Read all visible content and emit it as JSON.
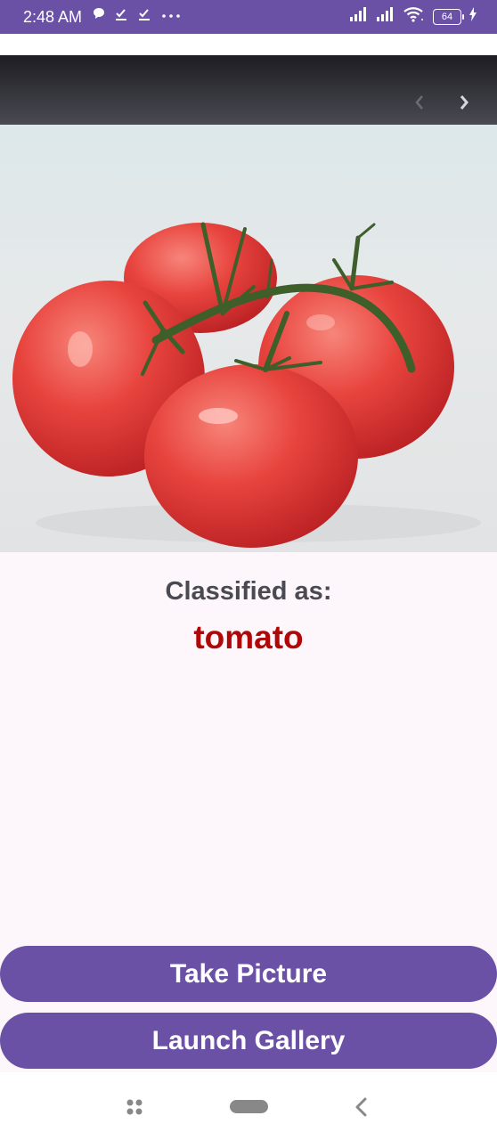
{
  "status_bar": {
    "time": "2:48 AM",
    "left_icons": [
      "chat-bubble-icon",
      "check-icon",
      "check-icon",
      "more-dots-icon"
    ],
    "battery_level": "64",
    "bg_color": "#6A51A6"
  },
  "image": {
    "subject": "tomatoes",
    "nav_prev_icon": "chevron-left-icon",
    "nav_next_icon": "chevron-right-icon"
  },
  "result": {
    "label": "Classified as:",
    "value": "tomato",
    "value_color": "#B00808"
  },
  "buttons": {
    "take_picture": "Take Picture",
    "launch_gallery": "Launch Gallery",
    "color": "#6A51A6"
  },
  "nav_bar": {
    "icons": [
      "recent-apps-icon",
      "home-icon",
      "back-icon"
    ]
  }
}
